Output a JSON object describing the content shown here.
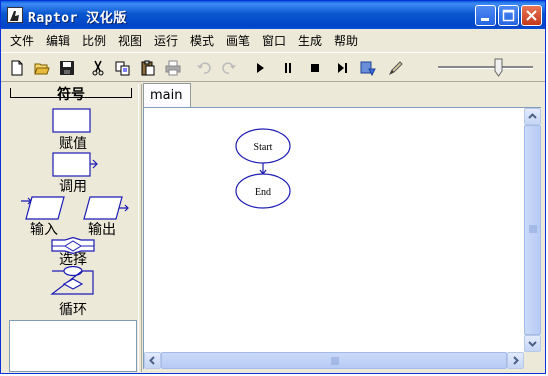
{
  "window": {
    "title": "Raptor 汉化版"
  },
  "menu": [
    "文件",
    "编辑",
    "比例",
    "视图",
    "运行",
    "模式",
    "画笔",
    "窗口",
    "生成",
    "帮助"
  ],
  "toolbar": {
    "buttons": [
      "new-icon",
      "open-icon",
      "save-icon",
      "cut-icon",
      "copy-icon",
      "paste-icon",
      "print-icon",
      "undo-icon",
      "redo-icon",
      "play-icon",
      "pause-icon",
      "stop-icon",
      "step-icon",
      "clear-icon",
      "pen-icon"
    ]
  },
  "symbols": {
    "title": "符号",
    "assignment": "赋值",
    "call": "调用",
    "input": "输入",
    "output": "输出",
    "selection": "选择",
    "loop": "循环"
  },
  "tabs": [
    "main"
  ],
  "flowchart": {
    "start": "Start",
    "end": "End"
  },
  "colors": {
    "shape_stroke": "#1c1cb4",
    "titlebar": "#0a58d0",
    "close_button": "#c3381b"
  }
}
